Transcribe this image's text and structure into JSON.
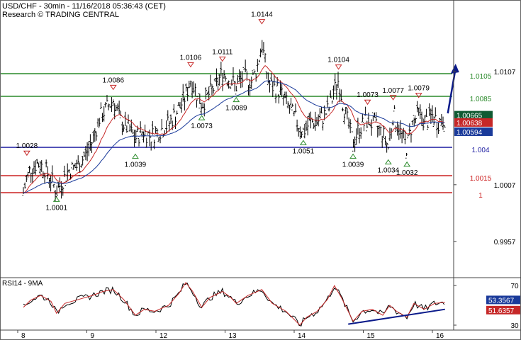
{
  "header": {
    "line1": "USD/CHF - 30min - 11/16/2018 05:36:43 (CET)",
    "line2": "Research © TRADING CENTRAL"
  },
  "chart_data": [
    {
      "type": "candlestick",
      "ylim": [
        0.9925,
        1.017
      ],
      "y_ticks": [
        {
          "value": 1.0107,
          "label": "1.0107"
        },
        {
          "value": 1.0007,
          "label": "1.0007"
        },
        {
          "value": 0.9957,
          "label": "0.9957"
        }
      ],
      "x_ticks": [
        "8",
        "9",
        "12",
        "13",
        "14",
        "15",
        "16"
      ],
      "levels": [
        {
          "value": 1.0105,
          "label": "1.0105",
          "color": "#2a8a2a",
          "kind": "resistance"
        },
        {
          "value": 1.0085,
          "label": "1.0085",
          "color": "#2a8a2a",
          "kind": "resistance"
        },
        {
          "value": 1.004,
          "label": "1.004",
          "color": "#1a1aa0",
          "kind": "pivot"
        },
        {
          "value": 1.0015,
          "label": "1.0015",
          "color": "#cc2020",
          "kind": "support"
        },
        {
          "value": 1.0,
          "label": "1",
          "color": "#cc2020",
          "kind": "support"
        }
      ],
      "price_tags": [
        {
          "value": 1.00665,
          "label": "1.00665",
          "color": "#0f5a32"
        },
        {
          "value": 1.00638,
          "label": "1.00638",
          "color": "#c62828"
        },
        {
          "value": 1.00594,
          "label": "1.00594",
          "color": "#1a3a9a"
        }
      ],
      "annotations": [
        {
          "x": 0.05,
          "value": 1.0028,
          "label": "1.0028",
          "type": "peak"
        },
        {
          "x": 0.48,
          "value": 1.0001,
          "label": "1.0001",
          "type": "trough"
        },
        {
          "x": 1.3,
          "value": 1.0086,
          "label": "1.0086",
          "type": "peak"
        },
        {
          "x": 1.62,
          "value": 1.0039,
          "label": "1.0039",
          "type": "trough"
        },
        {
          "x": 2.42,
          "value": 1.0106,
          "label": "1.0106",
          "type": "peak"
        },
        {
          "x": 2.58,
          "value": 1.0073,
          "label": "1.0073",
          "type": "trough"
        },
        {
          "x": 2.88,
          "value": 1.0111,
          "label": "1.0111",
          "type": "peak"
        },
        {
          "x": 3.08,
          "value": 1.0089,
          "label": "1.0089",
          "type": "trough"
        },
        {
          "x": 3.45,
          "value": 1.0144,
          "label": "1.0144",
          "type": "peak"
        },
        {
          "x": 4.05,
          "value": 1.0051,
          "label": "1.0051",
          "type": "trough"
        },
        {
          "x": 4.56,
          "value": 1.0104,
          "label": "1.0104",
          "type": "peak"
        },
        {
          "x": 4.77,
          "value": 1.0039,
          "label": "1.0039",
          "type": "trough"
        },
        {
          "x": 4.98,
          "value": 1.0073,
          "label": "1.0073",
          "type": "peak"
        },
        {
          "x": 5.28,
          "value": 1.0034,
          "label": "1.0034",
          "type": "trough"
        },
        {
          "x": 5.35,
          "value": 1.0077,
          "label": "1.0077",
          "type": "peak"
        },
        {
          "x": 5.55,
          "value": 1.0032,
          "label": "1.0032",
          "type": "trough"
        },
        {
          "x": 5.72,
          "value": 1.0079,
          "label": "1.0079",
          "type": "peak"
        }
      ],
      "forecast": {
        "from_value": 1.007,
        "to_value": 1.011
      },
      "moving_averages": [
        {
          "color": "#c62828"
        },
        {
          "color": "#1a3a9a"
        }
      ],
      "path": [
        [
          0.0,
          1.0
        ],
        [
          0.05,
          1.0012
        ],
        [
          0.1,
          1.0022
        ],
        [
          0.2,
          1.0026
        ],
        [
          0.3,
          1.0022
        ],
        [
          0.4,
          1.0012
        ],
        [
          0.48,
          1.0001
        ],
        [
          0.56,
          1.001
        ],
        [
          0.66,
          1.002
        ],
        [
          0.8,
          1.0024
        ],
        [
          0.92,
          1.0036
        ],
        [
          1.0,
          1.0046
        ],
        [
          1.1,
          1.0066
        ],
        [
          1.2,
          1.0074
        ],
        [
          1.3,
          1.0082
        ],
        [
          1.4,
          1.0064
        ],
        [
          1.52,
          1.0056
        ],
        [
          1.62,
          1.0048
        ],
        [
          1.72,
          1.0054
        ],
        [
          1.85,
          1.005
        ],
        [
          2.0,
          1.0056
        ],
        [
          2.12,
          1.0062
        ],
        [
          2.25,
          1.0074
        ],
        [
          2.35,
          1.0086
        ],
        [
          2.42,
          1.01
        ],
        [
          2.52,
          1.0086
        ],
        [
          2.58,
          1.0078
        ],
        [
          2.7,
          1.0088
        ],
        [
          2.8,
          1.0096
        ],
        [
          2.88,
          1.0106
        ],
        [
          2.98,
          1.01
        ],
        [
          3.08,
          1.0094
        ],
        [
          3.18,
          1.0102
        ],
        [
          3.3,
          1.0098
        ],
        [
          3.38,
          1.011
        ],
        [
          3.45,
          1.0132
        ],
        [
          3.55,
          1.0096
        ],
        [
          3.7,
          1.009
        ],
        [
          3.85,
          1.0074
        ],
        [
          4.0,
          1.0058
        ],
        [
          4.05,
          1.0054
        ],
        [
          4.15,
          1.0062
        ],
        [
          4.3,
          1.0064
        ],
        [
          4.42,
          1.0074
        ],
        [
          4.5,
          1.009
        ],
        [
          4.56,
          1.01
        ],
        [
          4.62,
          1.008
        ],
        [
          4.7,
          1.006
        ],
        [
          4.77,
          1.0044
        ],
        [
          4.85,
          1.0056
        ],
        [
          4.98,
          1.0064
        ],
        [
          5.1,
          1.0058
        ],
        [
          5.2,
          1.0052
        ],
        [
          5.28,
          1.004
        ],
        [
          5.35,
          1.007
        ],
        [
          5.45,
          1.0054
        ],
        [
          5.55,
          1.004
        ],
        [
          5.62,
          1.006
        ],
        [
          5.72,
          1.007
        ],
        [
          5.82,
          1.0062
        ],
        [
          5.92,
          1.0068
        ],
        [
          6.0,
          1.0062
        ],
        [
          6.1,
          1.0066
        ]
      ]
    },
    {
      "type": "line",
      "title": "RSI14 - 9MA",
      "ylim": [
        25,
        78
      ],
      "y_ticks": [
        {
          "value": 70,
          "label": "70"
        },
        {
          "value": 30,
          "label": "30"
        }
      ],
      "tags": [
        {
          "value": 53.3567,
          "label": "53.3567",
          "color": "#1a3a9a"
        },
        {
          "value": 51.6357,
          "label": "51.6357",
          "color": "#c62828"
        }
      ],
      "trendline": {
        "from": [
          4.7,
          31
        ],
        "to": [
          6.1,
          46
        ]
      },
      "path": [
        [
          0.0,
          48
        ],
        [
          0.1,
          55
        ],
        [
          0.25,
          60
        ],
        [
          0.4,
          54
        ],
        [
          0.48,
          42
        ],
        [
          0.6,
          52
        ],
        [
          0.8,
          56
        ],
        [
          1.0,
          60
        ],
        [
          1.15,
          64
        ],
        [
          1.3,
          66
        ],
        [
          1.45,
          56
        ],
        [
          1.62,
          40
        ],
        [
          1.75,
          46
        ],
        [
          1.9,
          44
        ],
        [
          2.1,
          50
        ],
        [
          2.25,
          62
        ],
        [
          2.35,
          73
        ],
        [
          2.45,
          64
        ],
        [
          2.58,
          48
        ],
        [
          2.7,
          58
        ],
        [
          2.88,
          64
        ],
        [
          3.0,
          58
        ],
        [
          3.08,
          52
        ],
        [
          3.25,
          60
        ],
        [
          3.45,
          66
        ],
        [
          3.6,
          52
        ],
        [
          3.8,
          44
        ],
        [
          4.0,
          30
        ],
        [
          4.1,
          38
        ],
        [
          4.25,
          44
        ],
        [
          4.4,
          56
        ],
        [
          4.5,
          70
        ],
        [
          4.6,
          58
        ],
        [
          4.77,
          34
        ],
        [
          4.9,
          44
        ],
        [
          5.05,
          46
        ],
        [
          5.2,
          40
        ],
        [
          5.3,
          50
        ],
        [
          5.4,
          44
        ],
        [
          5.55,
          38
        ],
        [
          5.65,
          52
        ],
        [
          5.8,
          46
        ],
        [
          5.95,
          52
        ],
        [
          6.1,
          53
        ]
      ]
    }
  ]
}
